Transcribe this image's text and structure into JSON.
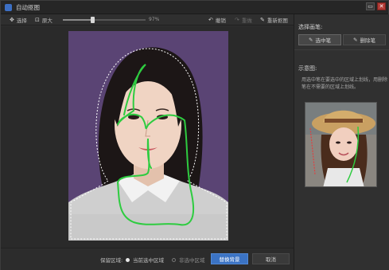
{
  "window": {
    "title": "自动抠图",
    "minimize_icon": "minimize-icon",
    "close_icon": "close-icon"
  },
  "toolbar": {
    "select_label": "选择",
    "zoom_label": "原大",
    "zoom_percent": "97%",
    "zoom_fraction": 0.36,
    "undo_label": "撤销",
    "redo_label": "重做",
    "redraw_label": "重新抠图"
  },
  "side": {
    "pen_title": "选择画笔:",
    "select_pen_label": "选中笔",
    "erase_pen_label": "删除笔",
    "example_title": "示意图:",
    "example_desc": "用选中笔在要选中的区域上划线，用删除笔在不需要的区域上划线。"
  },
  "bottom": {
    "keep_label": "保留区域:",
    "option_current": "当前选中区域",
    "option_unselected": "非选中区域",
    "replace_button": "替换背景",
    "cancel_button": "取消"
  },
  "colors": {
    "accent": "#3b73c4",
    "stroke_green": "#2ecc40",
    "photo_background": "#5a4474"
  }
}
